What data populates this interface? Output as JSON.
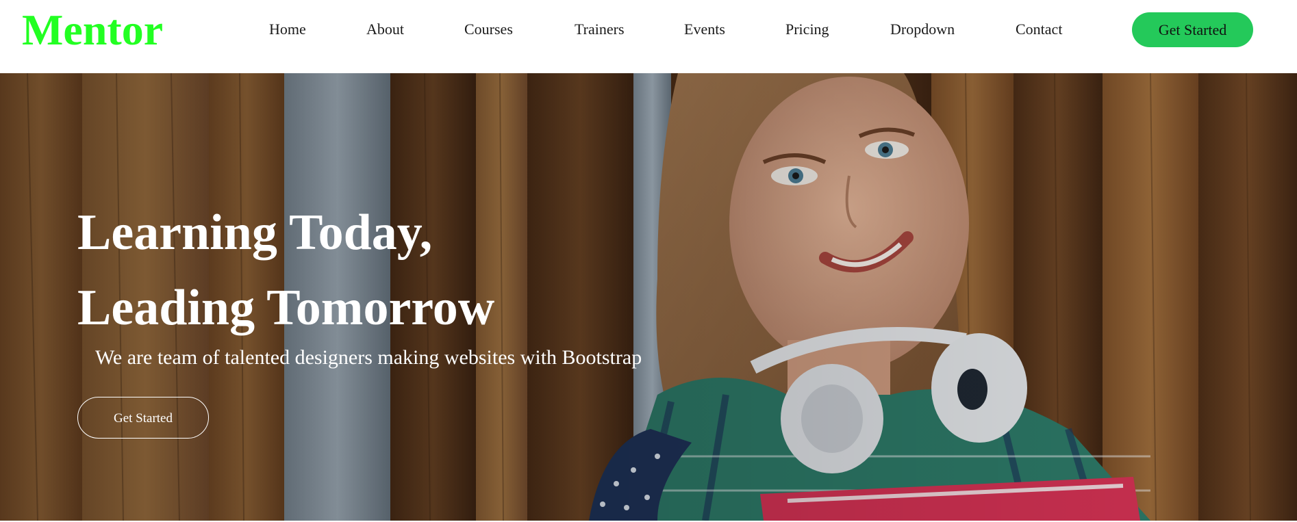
{
  "header": {
    "logo": "Mentor",
    "nav": [
      {
        "label": "Home"
      },
      {
        "label": "About"
      },
      {
        "label": "Courses"
      },
      {
        "label": "Trainers"
      },
      {
        "label": "Events"
      },
      {
        "label": "Pricing"
      },
      {
        "label": "Dropdown"
      },
      {
        "label": "Contact"
      }
    ],
    "cta_label": "Get Started"
  },
  "hero": {
    "title_line1": "Learning Today,",
    "title_line2": "Leading Tomorrow",
    "subtitle": "We are team of talented designers making websites with Bootstrap",
    "button_label": "Get Started",
    "image_icon": "student-photo"
  },
  "colors": {
    "logo": "#22ff22",
    "cta": "#24c95a",
    "nav_text": "#1a1a1a",
    "hero_text": "#ffffff"
  }
}
